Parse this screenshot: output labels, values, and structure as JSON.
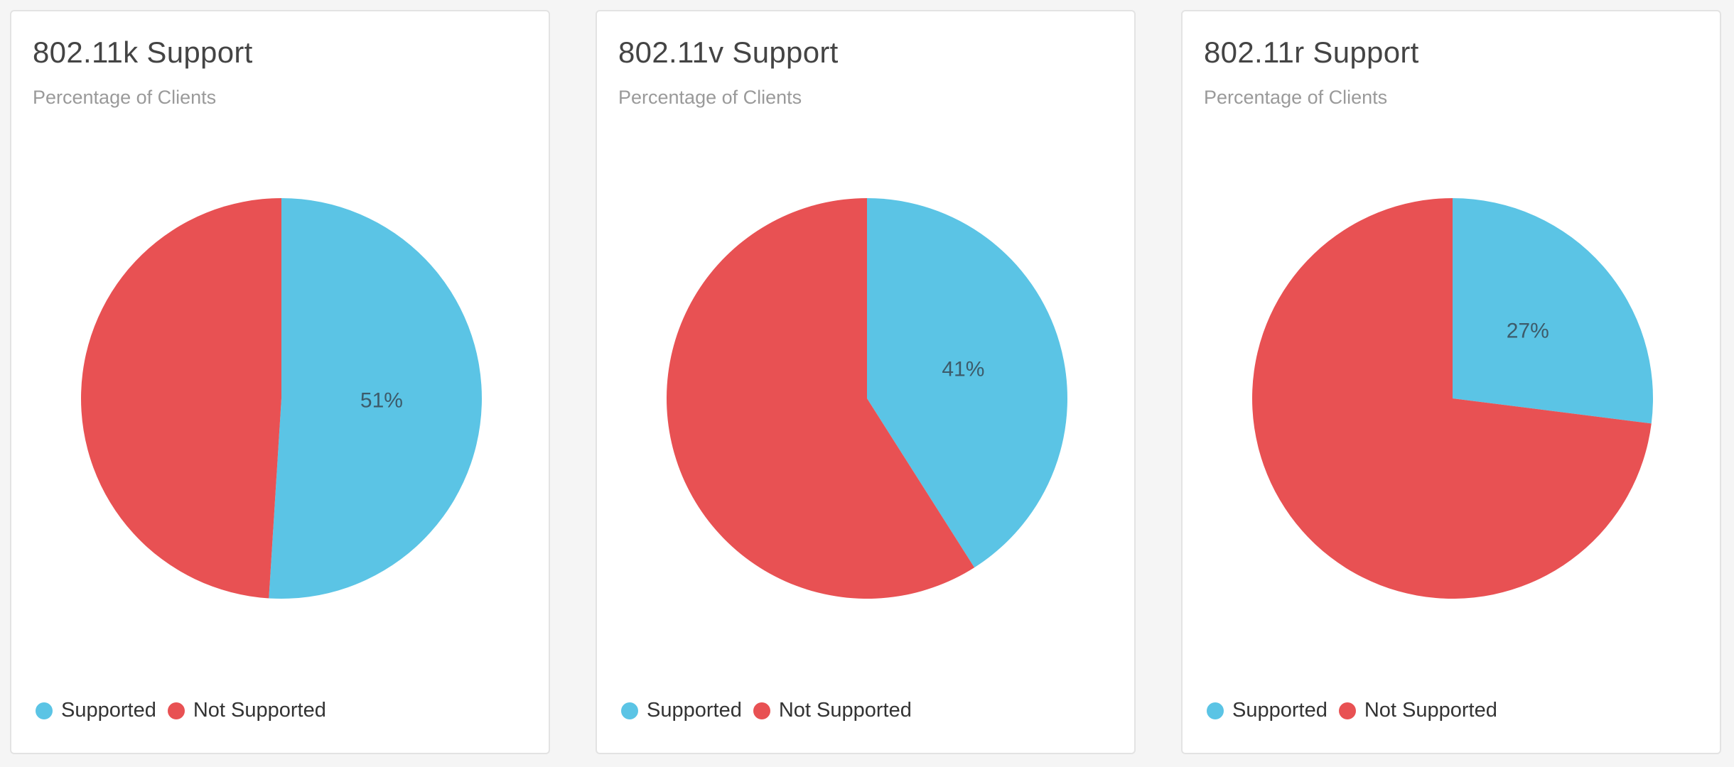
{
  "colors": {
    "supported": "#5bc4e5",
    "not_supported": "#e85153"
  },
  "legend": {
    "supported": "Supported",
    "not_supported": "Not Supported"
  },
  "chart_data": [
    {
      "type": "pie",
      "title": "802.11k Support",
      "subtitle": "Percentage of Clients",
      "slices": [
        {
          "name": "Supported",
          "value": 51,
          "label": "51%"
        },
        {
          "name": "Not Supported",
          "value": 49,
          "label": ""
        }
      ]
    },
    {
      "type": "pie",
      "title": "802.11v Support",
      "subtitle": "Percentage of Clients",
      "slices": [
        {
          "name": "Supported",
          "value": 41,
          "label": "41%"
        },
        {
          "name": "Not Supported",
          "value": 59,
          "label": ""
        }
      ]
    },
    {
      "type": "pie",
      "title": "802.11r Support",
      "subtitle": "Percentage of Clients",
      "slices": [
        {
          "name": "Supported",
          "value": 27,
          "label": "27%"
        },
        {
          "name": "Not Supported",
          "value": 73,
          "label": ""
        }
      ]
    }
  ]
}
